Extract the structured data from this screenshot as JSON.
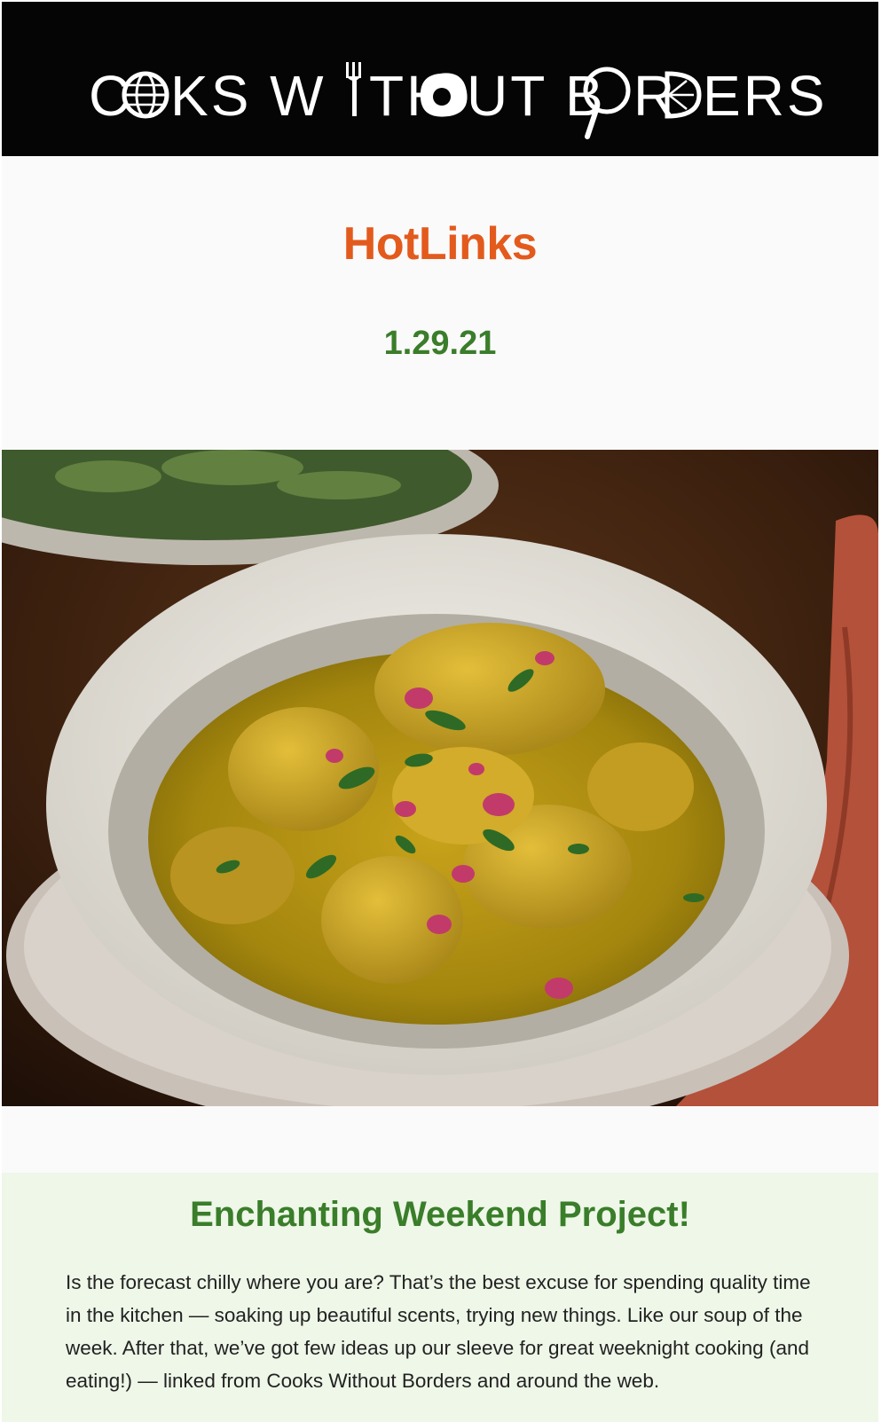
{
  "header": {
    "logo_parts": [
      "C",
      "KS W",
      "TH",
      "UT B",
      "R",
      "ERS"
    ]
  },
  "newsletter": {
    "title": "HotLinks",
    "date": "1.29.21"
  },
  "hero": {
    "subject": "bowl of golden turmeric soup with dumplings, herbs and rose petals"
  },
  "intro": {
    "heading": "Enchanting Weekend Project!",
    "body": "Is the forecast chilly where you are? That’s the best excuse for spending quality time in the kitchen — soaking up beautiful scents, trying new things. Like our soup of the week. After that, we’ve got few ideas up our sleeve for great weeknight cooking (and eating!) — linked from Cooks Without Borders and around the web."
  },
  "colors": {
    "banner": "#050505",
    "title_orange": "#e35a1d",
    "accent_green": "#3a7d2a",
    "intro_bg": "#eef7e8"
  }
}
